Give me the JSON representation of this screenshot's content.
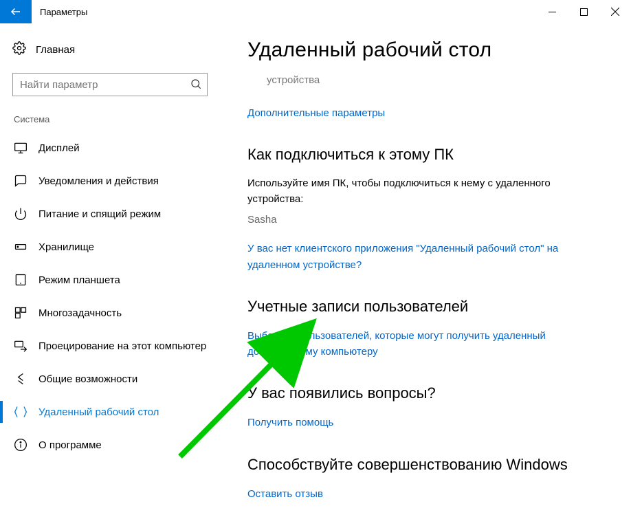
{
  "window": {
    "title": "Параметры"
  },
  "sidebar": {
    "home": "Главная",
    "search_placeholder": "Найти параметр",
    "group": "Система",
    "items": [
      {
        "label": "Дисплей"
      },
      {
        "label": "Уведомления и действия"
      },
      {
        "label": "Питание и спящий режим"
      },
      {
        "label": "Хранилище"
      },
      {
        "label": "Режим планшета"
      },
      {
        "label": "Многозадачность"
      },
      {
        "label": "Проецирование на этот компьютер"
      },
      {
        "label": "Общие возможности"
      },
      {
        "label": "Удаленный рабочий стол"
      },
      {
        "label": "О программе"
      }
    ]
  },
  "main": {
    "title": "Удаленный рабочий стол",
    "truncated_tail": "устройства",
    "adv_link": "Дополнительные параметры",
    "connect_h": "Как подключиться к этому ПК",
    "connect_text": "Используйте имя ПК, чтобы подключиться к нему с удаленного устройства:",
    "pc_name": "Sasha",
    "no_client_link": "У вас нет клиентского приложения \"Удаленный рабочий стол\" на удаленном устройстве?",
    "users_h": "Учетные записи пользователей",
    "users_link": "Выберите пользователей, которые могут получить удаленный доступ к этому компьютеру",
    "help_h": "У вас появились вопросы?",
    "help_link": "Получить помощь",
    "feedback_h": "Способствуйте совершенствованию Windows",
    "feedback_link": "Оставить отзыв"
  }
}
